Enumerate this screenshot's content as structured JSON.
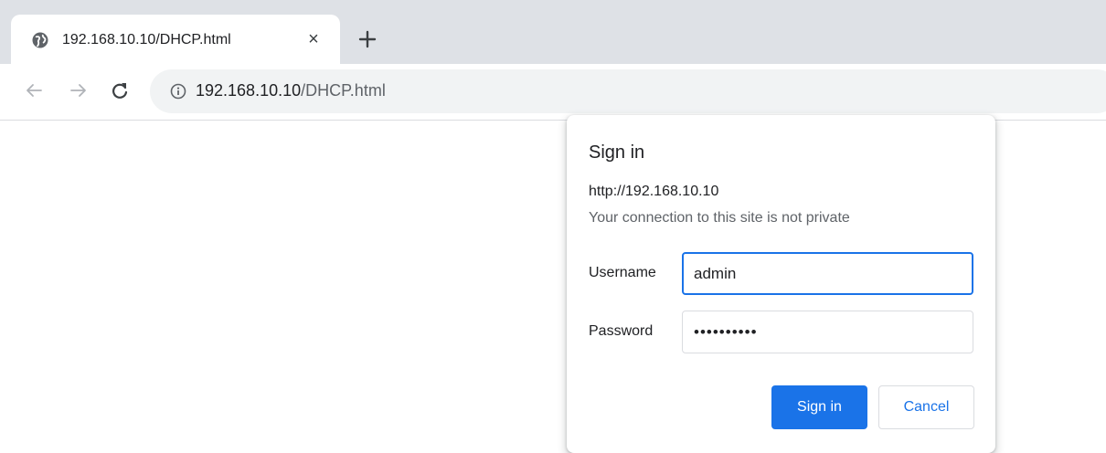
{
  "browser": {
    "tab": {
      "title": "192.168.10.10/DHCP.html",
      "favicon": "globe-icon",
      "close_glyph": "×"
    },
    "new_tab_icon": "plus-icon",
    "toolbar": {
      "back_icon": "arrow-left-icon",
      "forward_icon": "arrow-right-icon",
      "reload_icon": "reload-icon",
      "site_info_icon": "info-icon",
      "url_host": "192.168.10.10",
      "url_path": "/DHCP.html"
    }
  },
  "dialog": {
    "title": "Sign in",
    "origin": "http://192.168.10.10",
    "warning": "Your connection to this site is not private",
    "username_label": "Username",
    "username_value": "admin",
    "password_label": "Password",
    "password_value": "••••••••••",
    "sign_in_label": "Sign in",
    "cancel_label": "Cancel"
  },
  "colors": {
    "accent": "#1a73e8",
    "tabstrip": "#dee1e6",
    "omnibox": "#f1f3f4"
  }
}
